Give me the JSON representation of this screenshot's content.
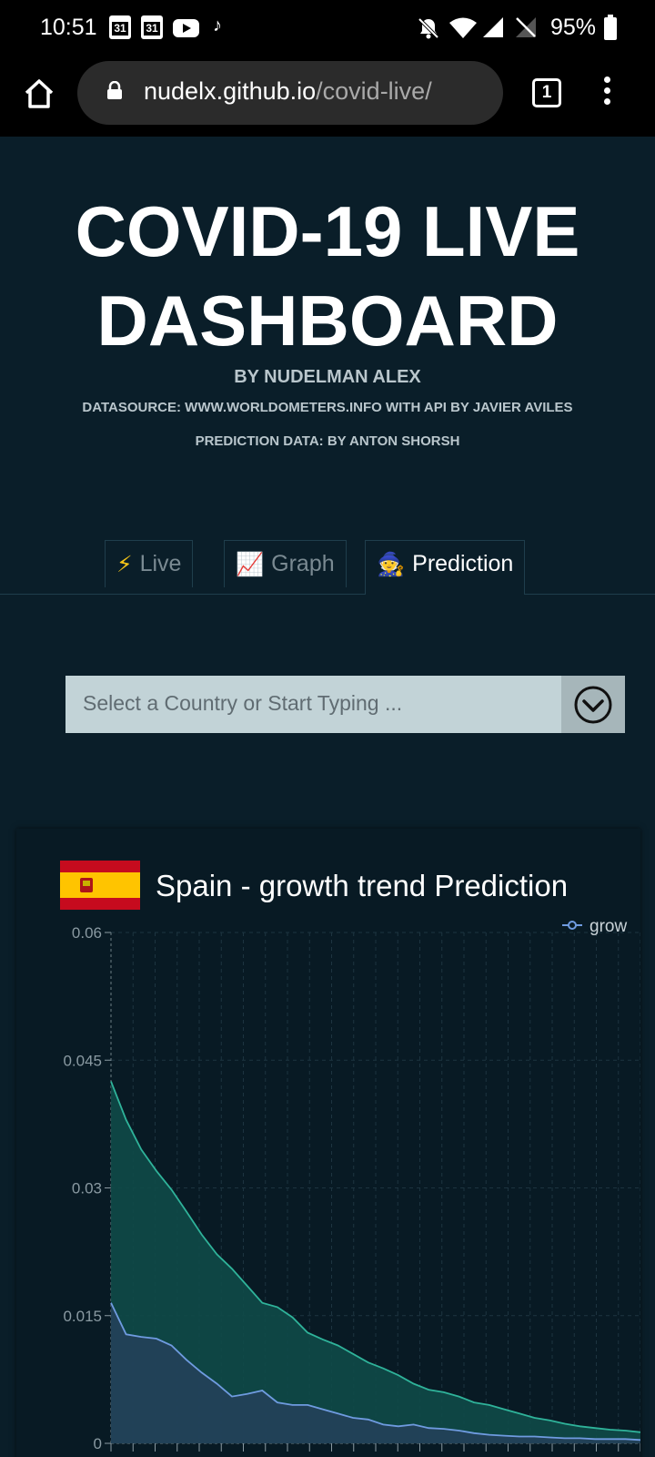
{
  "status_bar": {
    "time": "10:51",
    "calendar_day_1": "31",
    "calendar_day_2": "31",
    "battery": "95%"
  },
  "browser": {
    "url_host": "nudelx.github.io",
    "url_path": "/covid-live/",
    "tab_count": "1"
  },
  "header": {
    "title_line1": "COVID-19 LIVE",
    "title_line2": "DASHBOARD",
    "byline": "BY NUDELMAN ALEX",
    "datasource": "DATASOURCE: WWW.WORLDOMETERS.INFO WITH API BY JAVIER AVILES",
    "prediction_data": "PREDICTION DATA: BY ANTON SHORSH"
  },
  "tabs": [
    {
      "label": "Live",
      "icon": "⚡"
    },
    {
      "label": "Graph",
      "icon": "📈"
    },
    {
      "label": "Prediction",
      "icon": "🧙"
    }
  ],
  "select": {
    "placeholder": "Select a Country or Start Typing ..."
  },
  "colors": {
    "page_bg": "#0a1e29",
    "card_bg": "#081a24",
    "teal_fill": "#0f4a48",
    "teal_line": "#2fb39a",
    "blue_fill": "#23405a",
    "blue_line": "#6f9be0"
  },
  "chart_data": {
    "type": "area",
    "title": "Spain - growth trend Prediction",
    "legend": [
      "grow"
    ],
    "legend_position": "top-right",
    "ylim": [
      0,
      0.06
    ],
    "y_ticks": [
      "0",
      "0.015",
      "0.03",
      "0.045",
      "0.06"
    ],
    "grid": true,
    "series": [
      {
        "name": "grow",
        "values": [
          0.0425,
          0.038,
          0.0345,
          0.032,
          0.0298,
          0.0272,
          0.0245,
          0.0222,
          0.0205,
          0.0185,
          0.0165,
          0.016,
          0.0148,
          0.013,
          0.0122,
          0.0115,
          0.0105,
          0.0095,
          0.0088,
          0.008,
          0.007,
          0.0063,
          0.006,
          0.0055,
          0.0048,
          0.0045,
          0.004,
          0.0035,
          0.003,
          0.0027,
          0.0023,
          0.002,
          0.0018,
          0.0016,
          0.0015,
          0.0013
        ]
      },
      {
        "name": "",
        "values": [
          0.0165,
          0.0128,
          0.0125,
          0.0123,
          0.0115,
          0.0098,
          0.0083,
          0.007,
          0.0055,
          0.0058,
          0.0062,
          0.0048,
          0.0045,
          0.0045,
          0.004,
          0.0035,
          0.003,
          0.0028,
          0.0022,
          0.002,
          0.0022,
          0.0018,
          0.0017,
          0.0015,
          0.0012,
          0.001,
          0.0009,
          0.0008,
          0.0008,
          0.0007,
          0.0006,
          0.0006,
          0.0005,
          0.0005,
          0.0005,
          0.0004
        ]
      }
    ]
  }
}
